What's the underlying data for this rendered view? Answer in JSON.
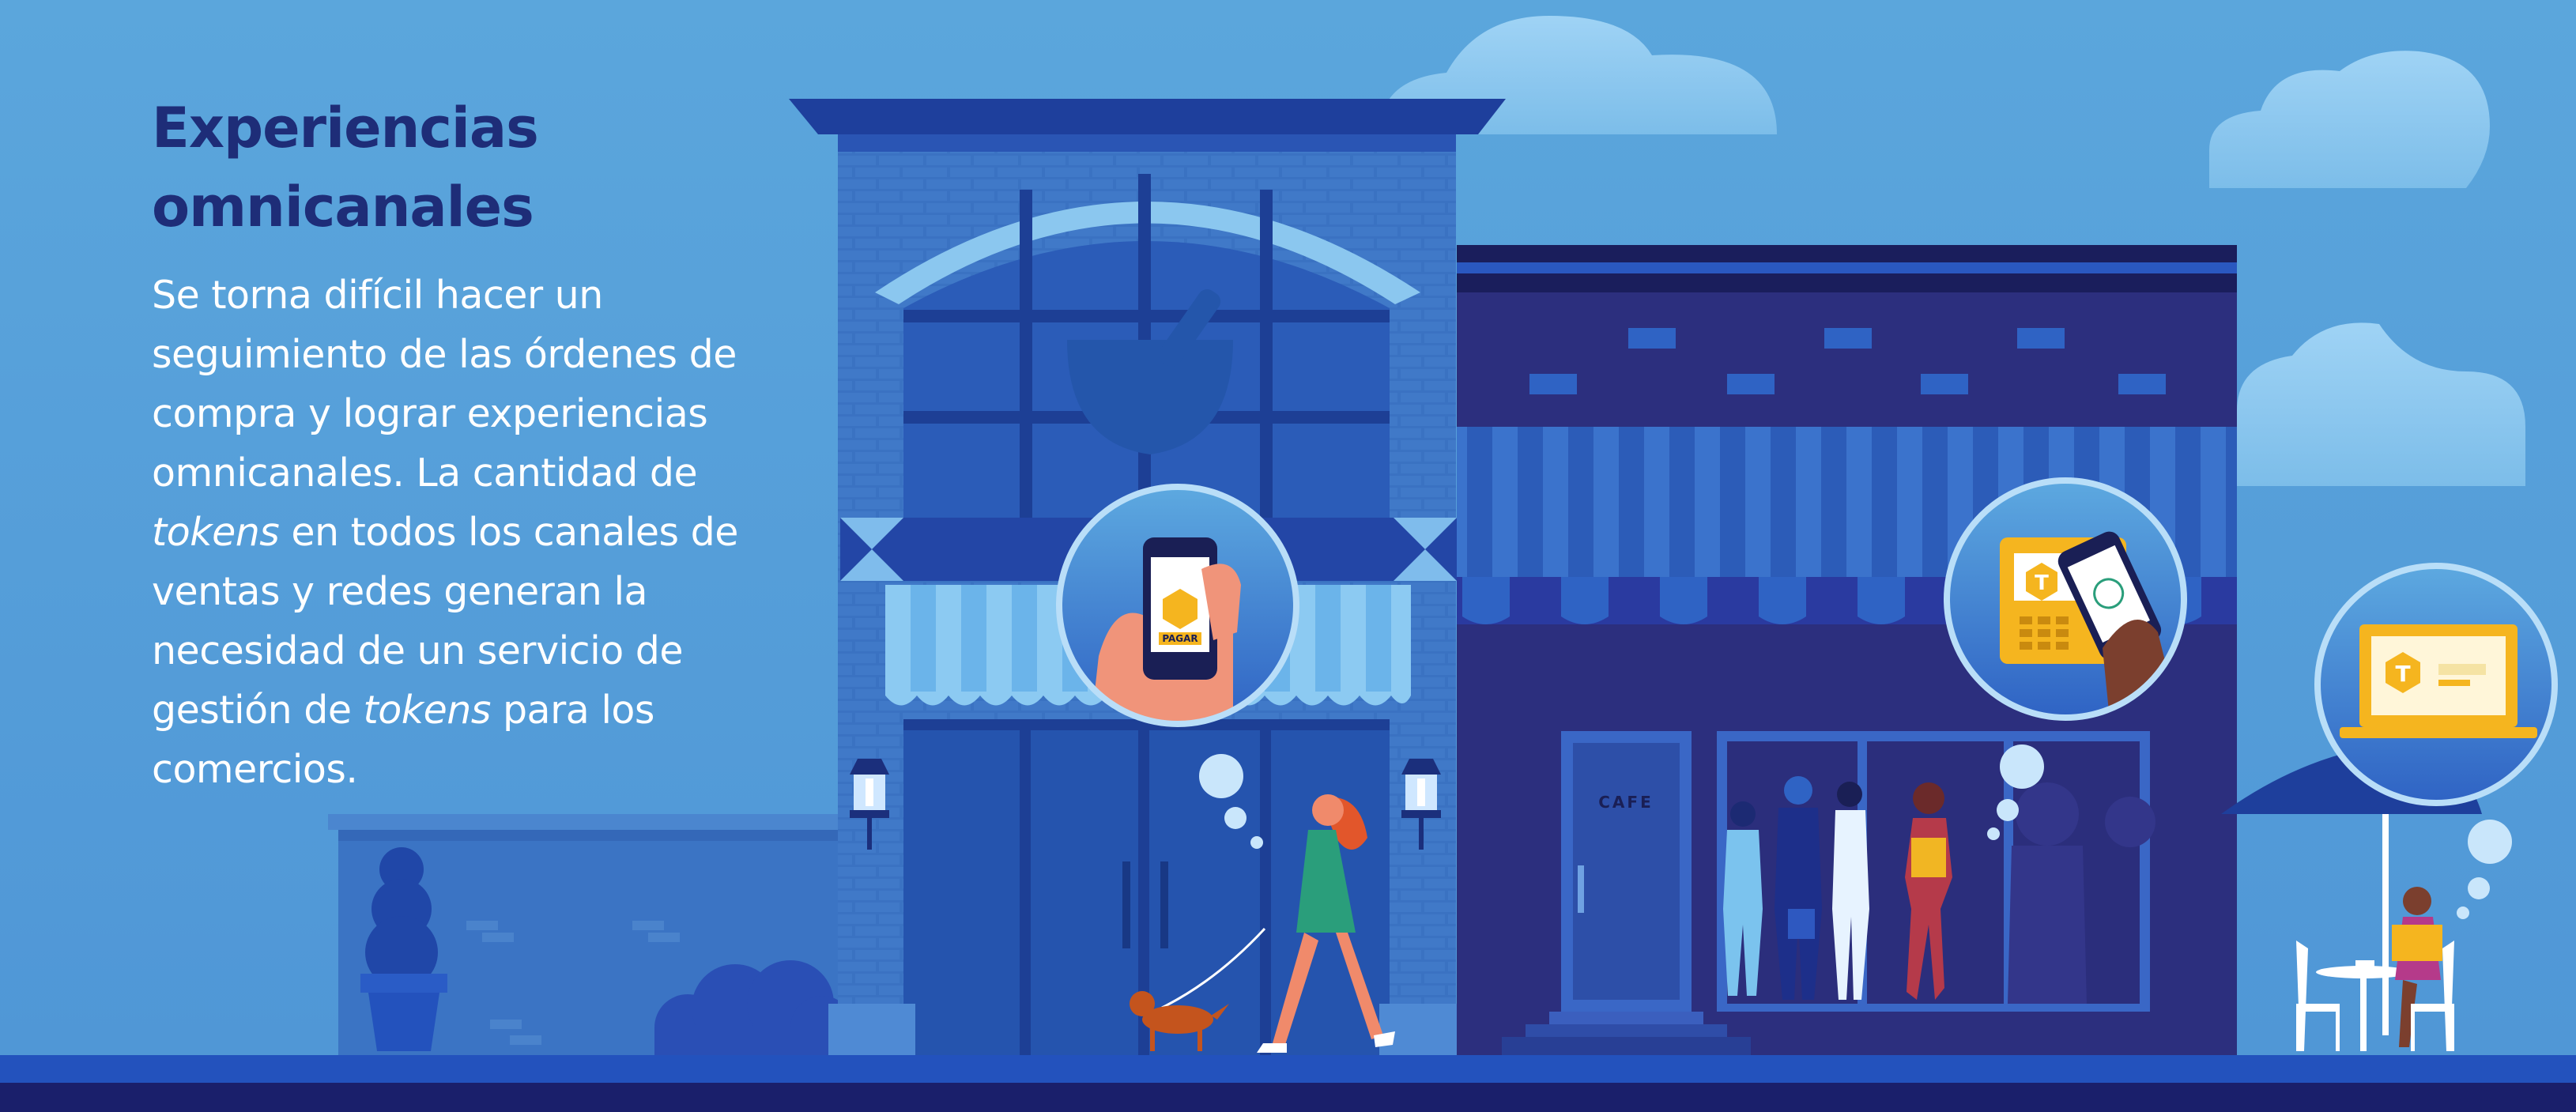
{
  "headline": {
    "line1": "Experiencias",
    "line2": "omnicanales"
  },
  "body": {
    "p1": "Se torna difícil hacer un seguimiento de las órdenes de compra y lograr experiencias omnicanales. La cantidad de",
    "em1": "tokens",
    "p2": "en todos los canales de ventas y redes generan la necesidad de un servicio de gestión de",
    "em2": "tokens",
    "p3": "para los comercios."
  },
  "scene": {
    "cafe_sign": "CAFE",
    "phone_pay_label": "PAGAR",
    "token_glyph": "T"
  },
  "colors": {
    "sky": "#5ea8dc",
    "heading": "#1e2d78",
    "body_text": "#ffffff",
    "building_left": "#2f67b9",
    "building_right": "#2b2f7c",
    "street": "#1f3f9e",
    "token_gold": "#f5b51f"
  },
  "icons": [
    "cloud-icon",
    "phone-pay-icon",
    "pos-terminal-icon",
    "laptop-icon",
    "token-icon",
    "street-lamp-icon",
    "thought-bubble-icon"
  ]
}
